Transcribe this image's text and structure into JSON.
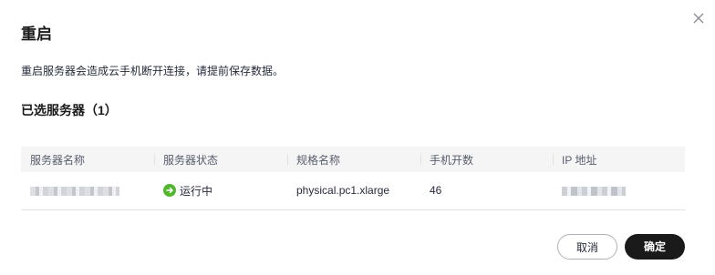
{
  "dialog": {
    "title": "重启",
    "notice": "重启服务器会造成云手机断开连接，请提前保存数据。",
    "selected_heading": "已选服务器（1）"
  },
  "table": {
    "headers": [
      "服务器名称",
      "服务器状态",
      "规格名称",
      "手机开数",
      "IP 地址"
    ],
    "rows": [
      {
        "status": "运行中",
        "spec": "physical.pc1.xlarge",
        "phone_count": "46"
      }
    ]
  },
  "buttons": {
    "cancel": "取消",
    "confirm": "确定"
  },
  "colors": {
    "status_running": "#50b72d",
    "primary_button": "#1a1a1a"
  },
  "icons": {
    "close": "close-icon",
    "status": "arrow-right-circle-icon"
  }
}
